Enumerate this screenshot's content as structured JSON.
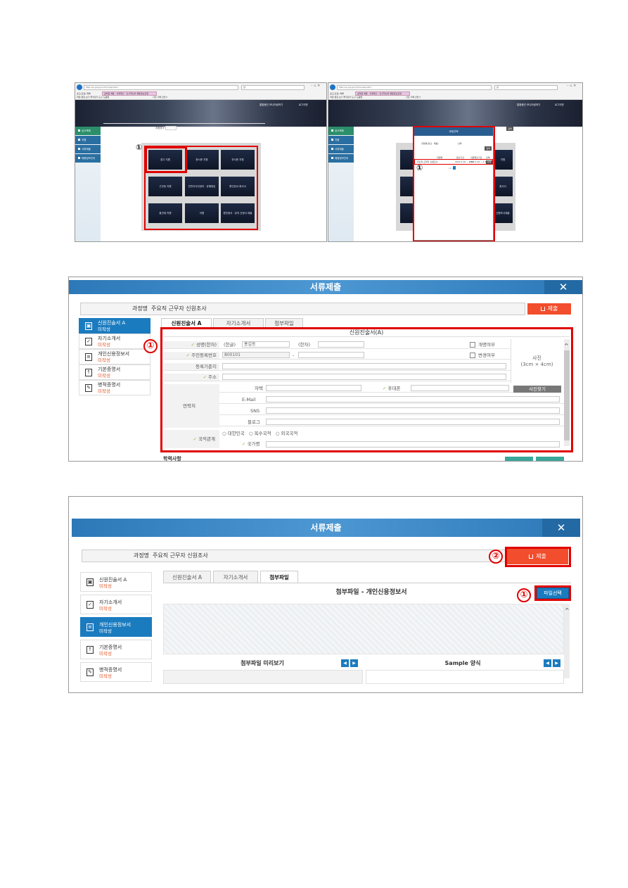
{
  "panel1": {
    "left_shot": {
      "url": "http://ip.gd.go.kr/hrm/ssl/nafcc",
      "search": "감",
      "tab_title": "공부원 채용 · 서류제출 · 인사혁신처 채용정보포털",
      "browser_tab_text": "공고(모집) 목록",
      "menu": "파일  편집  보기  즐겨찾기  도구  도움말",
      "zoom_text": "사진  기록  안전 ▾",
      "banner_links": [
        "통합중인 모니터링하기",
        "로그아웃"
      ],
      "sidenav": [
        "공고목록",
        "지원",
        "서류제출",
        "채용정보관리"
      ],
      "search_label": "과정명 ▾",
      "tiles": [
        "경고 지원",
        "증서준 지원",
        "부서준 지원",
        "근무등 지원",
        "전민지서전센터 · 유해정임",
        "원인정서 증서서",
        "통관재 지원",
        "지원",
        "원인정서 · 유의 신청서 제출"
      ],
      "marker": "①"
    },
    "right_shot": {
      "url": "http://ip.gd.go.kr/hrm/ssl/nafcc",
      "search": "감",
      "tab_title": "공부원 채용 · 서류제출 · 인사혁신처 채용정보포털",
      "browser_tab_text": "공고(모집) 목록",
      "menu": "파일  편집  보기  즐겨찾기  도구  도움말",
      "zoom_text": "사진  기록  안전 ▾",
      "banner_links": [
        "통합중인 모니터링하기",
        "로그아웃"
      ],
      "sidenav": [
        "공고목록",
        "지원",
        "서류제출",
        "채용정보관리"
      ],
      "modal_title": "과정선택",
      "modal_field_label": "과정명(정규 · 채용)",
      "modal_field_value": "선택",
      "modal_search_btn": "검색",
      "modal_columns": [
        "과정명",
        "접수기간",
        "서류제출기간",
        "선택"
      ],
      "modal_row": [
        "주요직 근무자 신원조사",
        "2023.1.10 ~ 1.20",
        "2023.1.10 ~ 1.31",
        "선택"
      ],
      "modal_pager": "‹  1  ›",
      "side_tile_texts": [
        "지원",
        "증서서",
        "신원조사제출"
      ],
      "header_btn": "검색",
      "marker": "①"
    }
  },
  "panel2": {
    "title": "서류제출",
    "close_icon": "✕",
    "course_label": "과정명",
    "course_value": "주요직 근무자 신원조사",
    "submit_label": "제출",
    "docs": [
      {
        "name": "신원진술서 A",
        "status": "미작성",
        "icon": "shield-icon",
        "glyph": "▣"
      },
      {
        "name": "자기소개서",
        "status": "미작성",
        "icon": "check-box-icon",
        "glyph": "✓"
      },
      {
        "name": "개인신용정보서",
        "status": "미작성",
        "icon": "document-icon",
        "glyph": "≡"
      },
      {
        "name": "기본증명서",
        "status": "미작성",
        "icon": "upload-icon",
        "glyph": "↑"
      },
      {
        "name": "병적증명서",
        "status": "미작성",
        "icon": "edit-icon",
        "glyph": "✎"
      }
    ],
    "tabs": [
      "신원진술서 A",
      "자기소개서",
      "첨부파일"
    ],
    "form_title": "신원진술서(A)",
    "name_label": "성명(한자)",
    "hangul_label": "(한글)",
    "hangul_value": "홍길동",
    "hanja_label": "(한자)",
    "rename_label": "개명여부",
    "rrn_label": "주민등록번호",
    "rrn_value": "800101",
    "rrn_dash": "-",
    "change_label": "변경여부",
    "photo_label": "사진",
    "photo_size": "(3cm × 4cm)",
    "photo_btn": "사진찾기",
    "regaddr_label": "등록기준지",
    "addr_label": "주소",
    "contact_label": "연락처",
    "home_label": "자택",
    "mobile_label": "휴대폰",
    "email_label": "E-Mail",
    "sns_label": "SNS",
    "blog_label": "블로그",
    "nationality_label": "국적관계",
    "nationality_options": [
      "대한민국",
      "복수국적",
      "외국국적"
    ],
    "country_label": "국가명",
    "cut_label": "학력사항",
    "marker": "①"
  },
  "panel3": {
    "title": "서류제출",
    "close_icon": "✕",
    "course_label": "과정명",
    "course_value": "주요직 근무자 신원조사",
    "submit_label": "제출",
    "docs": [
      {
        "name": "신원진술서 A",
        "status": "미작성",
        "icon": "shield-icon",
        "glyph": "▣"
      },
      {
        "name": "자기소개서",
        "status": "미작성",
        "icon": "check-box-icon",
        "glyph": "✓"
      },
      {
        "name": "개인신용정보서",
        "status": "미작성",
        "icon": "document-icon",
        "glyph": "≡"
      },
      {
        "name": "기본증명서",
        "status": "미작성",
        "icon": "upload-icon",
        "glyph": "↑"
      },
      {
        "name": "병적증명서",
        "status": "미작성",
        "icon": "edit-icon",
        "glyph": "✎"
      }
    ],
    "tabs": [
      "신원진술서 A",
      "자기소개서",
      "첨부파일"
    ],
    "attach_title": "첨부파일 - 개인신용정보서",
    "file_btn": "파일선택",
    "preview_label": "첨부파일 미리보기",
    "sample_label": "Sample 양식",
    "prev_glyph": "◀",
    "next_glyph": "▶",
    "marker1": "①",
    "marker2": "②"
  },
  "colors": {
    "titlebar": "#2c78b8",
    "submit": "#f24d2c",
    "active_doc": "#1b7bbf",
    "status_orange": "#e05a2a",
    "annotation_red": "#e00000",
    "check_green": "#7bbf3a"
  }
}
